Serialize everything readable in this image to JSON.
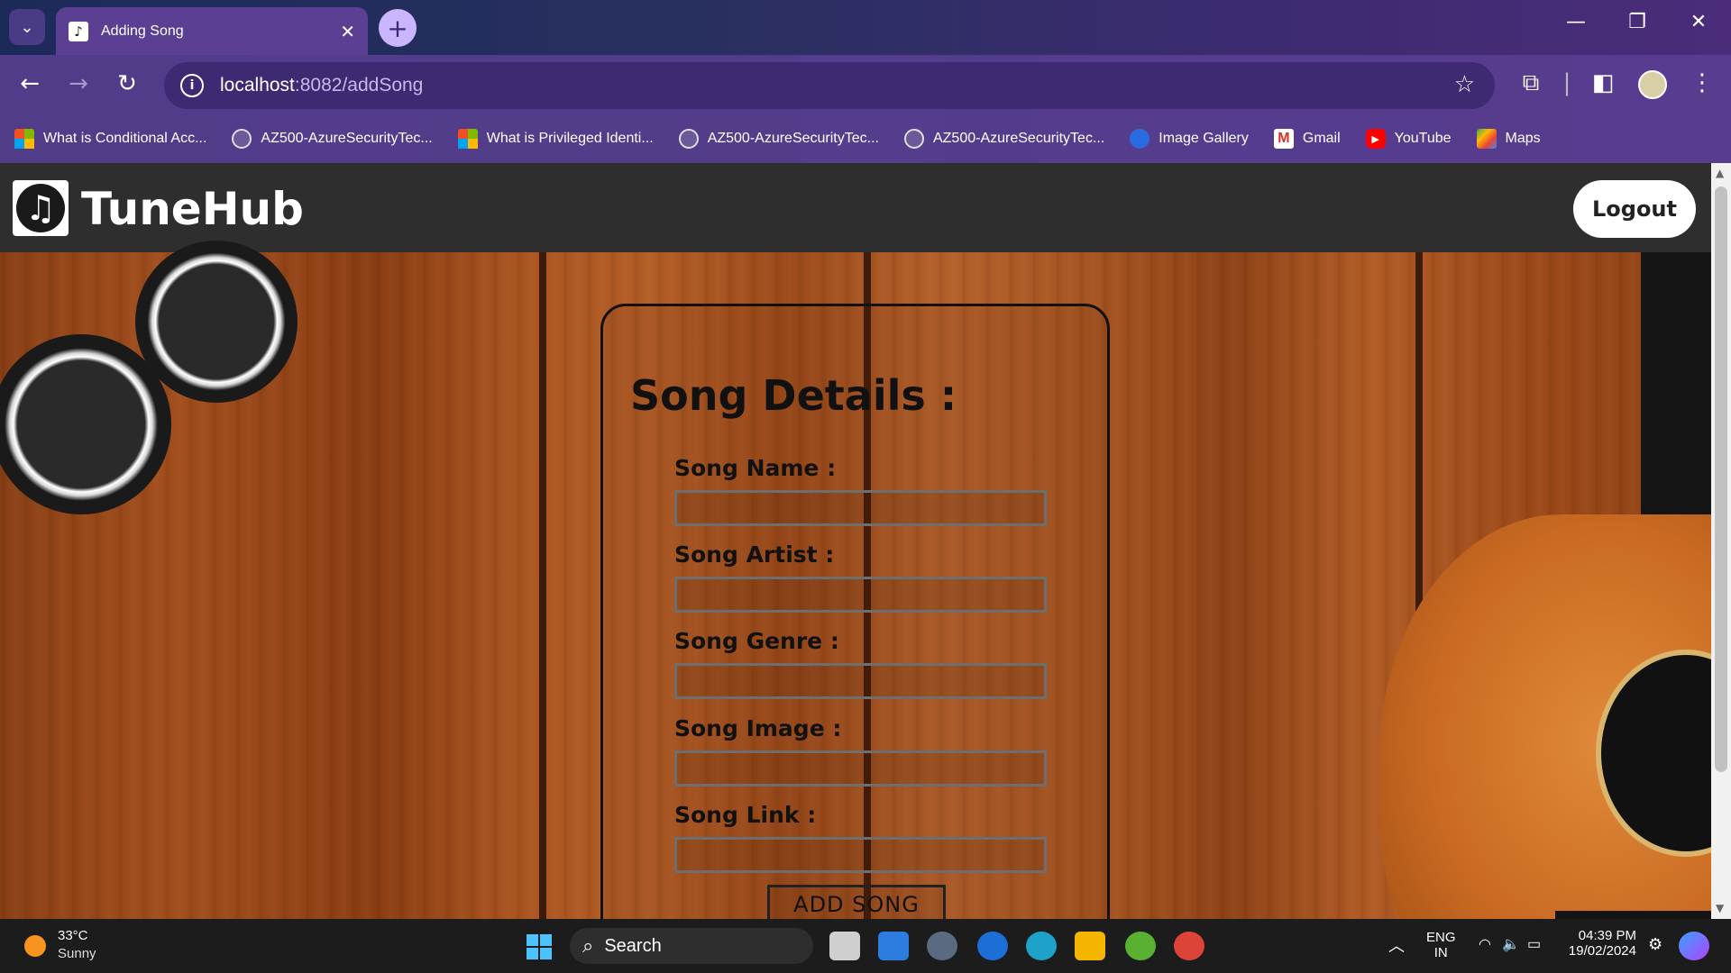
{
  "browser": {
    "tab_title": "Adding Song",
    "url_host": "localhost",
    "url_path": ":8082/addSong",
    "bookmarks": [
      {
        "label": "What is Conditional Acc...",
        "icon": "microsoft-icon"
      },
      {
        "label": "AZ500-AzureSecurityTec...",
        "icon": "globe-icon"
      },
      {
        "label": "What is Privileged Identi...",
        "icon": "microsoft-icon"
      },
      {
        "label": "AZ500-AzureSecurityTec...",
        "icon": "globe-icon"
      },
      {
        "label": "AZ500-AzureSecurityTec...",
        "icon": "globe-icon"
      },
      {
        "label": "Image Gallery",
        "icon": "gallery-icon"
      },
      {
        "label": "Gmail",
        "icon": "gmail-icon"
      },
      {
        "label": "YouTube",
        "icon": "youtube-icon"
      },
      {
        "label": "Maps",
        "icon": "maps-icon"
      }
    ]
  },
  "app": {
    "brand": "TuneHub",
    "logout_label": "Logout"
  },
  "form": {
    "title": "Song Details :",
    "fields": [
      {
        "label": "Song Name :",
        "value": ""
      },
      {
        "label": "Song Artist :",
        "value": ""
      },
      {
        "label": "Song Genre :",
        "value": ""
      },
      {
        "label": "Song Image :",
        "value": ""
      },
      {
        "label": "Song Link :",
        "value": ""
      }
    ],
    "submit_label": "ADD SONG"
  },
  "taskbar": {
    "weather_temp": "33°C",
    "weather_cond": "Sunny",
    "search_label": "Search",
    "lang_1": "ENG",
    "lang_2": "IN",
    "time": "04:39 PM",
    "date": "19/02/2024"
  },
  "colors": {
    "header_bg": "#2e2e2e",
    "chrome_accent": "#5a3f93",
    "wood_base": "#a24e1c"
  }
}
